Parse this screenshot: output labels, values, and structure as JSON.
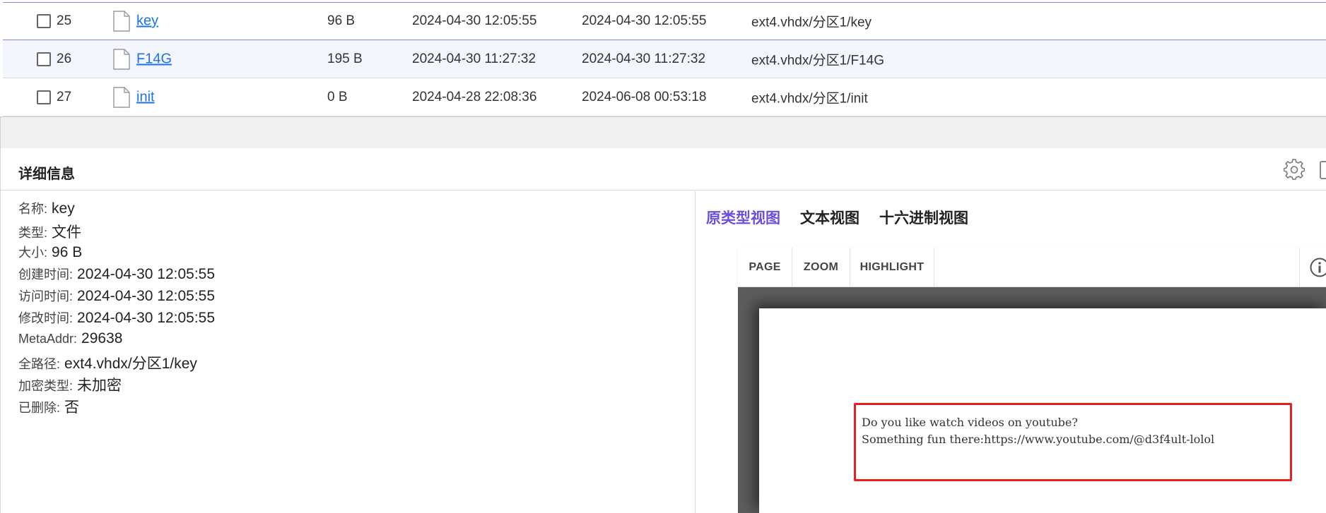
{
  "file_table": {
    "rows": [
      {
        "index": "25",
        "name": "key",
        "size": "96 B",
        "created": "2024-04-30 12:05:55",
        "modified": "2024-04-30 12:05:55",
        "path": "ext4.vhdx/分区1/key"
      },
      {
        "index": "26",
        "name": "F14G",
        "size": "195 B",
        "created": "2024-04-30 11:27:32",
        "modified": "2024-04-30 11:27:32",
        "path": "ext4.vhdx/分区1/F14G"
      },
      {
        "index": "27",
        "name": "init",
        "size": "0 B",
        "created": "2024-04-28 22:08:36",
        "modified": "2024-06-08 00:53:18",
        "path": "ext4.vhdx/分区1/init"
      }
    ]
  },
  "details": {
    "title": "详细信息",
    "properties": [
      {
        "key": "名称:",
        "value": "key"
      },
      {
        "key": "类型:",
        "value": "文件"
      },
      {
        "key": "大小:",
        "value": "96 B"
      },
      {
        "key": "创建时间:",
        "value": "2024-04-30 12:05:55"
      },
      {
        "key": "访问时间:",
        "value": "2024-04-30 12:05:55"
      },
      {
        "key": "修改时间:",
        "value": "2024-04-30 12:05:55"
      },
      {
        "key": "MetaAddr:",
        "value": "29638"
      },
      {
        "key": "全路径:",
        "value": "ext4.vhdx/分区1/key"
      },
      {
        "key": "加密类型:",
        "value": "未加密"
      },
      {
        "key": "已删除:",
        "value": "否"
      }
    ]
  },
  "viewer": {
    "tabs": [
      {
        "label": "原类型视图",
        "active": true
      },
      {
        "label": "文本视图",
        "active": false
      },
      {
        "label": "十六进制视图",
        "active": false
      }
    ],
    "toolbar": {
      "page": "PAGE",
      "zoom": "ZOOM",
      "highlight": "HIGHLIGHT"
    },
    "document_lines": [
      "Do you like watch videos on youtube?",
      "Something fun there:https://www.youtube.com/@d3f4ult-lolol"
    ]
  },
  "colors": {
    "active_tab": "#6c4fe0",
    "link": "#1a73e8",
    "selected_row_border": "#8b86e6",
    "highlight_box": "#e62020"
  },
  "icons": [
    "checkbox-icon",
    "file-icon",
    "gear-icon",
    "info-icon"
  ]
}
